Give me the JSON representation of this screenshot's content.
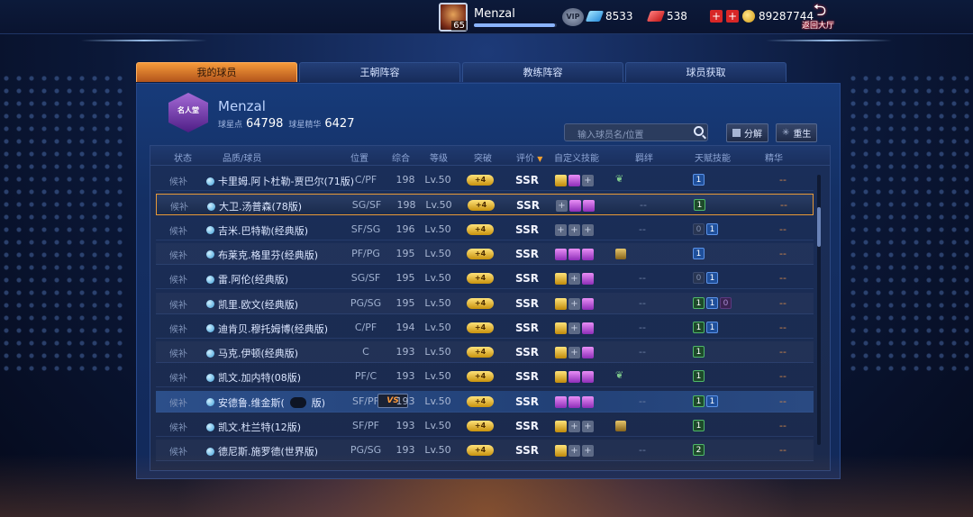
{
  "topbar": {
    "level": "65",
    "player_name": "Menzal",
    "xp_progress": 0.98,
    "vip_label": "VIP",
    "diamonds": "8533",
    "tickets": "538",
    "gold": "89287744",
    "back_label": "返回大厅"
  },
  "tabs": [
    {
      "label": "我的球员",
      "active": true
    },
    {
      "label": "王朝阵容",
      "active": false
    },
    {
      "label": "教练阵容",
      "active": false
    },
    {
      "label": "球员获取",
      "active": false
    }
  ],
  "profile": {
    "badge_text": "名人堂",
    "name": "Menzal",
    "star_points_label": "球星点",
    "star_points": "64798",
    "essence_label": "球星精华",
    "essence": "6427"
  },
  "search": {
    "placeholder": "输入球员名/位置"
  },
  "buttons": {
    "decompose": "分解",
    "rebirth": "重生"
  },
  "columns": {
    "status": "状态",
    "player": "品质/球员",
    "position": "位置",
    "overall": "综合",
    "level": "等级",
    "breakthrough": "突破",
    "rating": "评价",
    "custom_skills": "自定义技能",
    "bond": "羁绊",
    "talent": "天赋技能",
    "essence": "精华",
    "rating_sort_icon": "▼"
  },
  "rows": [
    {
      "status": "候补",
      "name": "卡里姆.阿卜杜勒-贾巴尔(71版)",
      "pos": "C/PF",
      "ovr": "198",
      "lv": "Lv.50",
      "brk": "+4",
      "rating": "SSR",
      "skills": [
        "g",
        "p",
        "e"
      ],
      "bond": "",
      "bond_icon": "leaf",
      "talent": [
        [
          "n",
          "1"
        ]
      ],
      "ess": "--"
    },
    {
      "status": "候补",
      "name": "大卫.汤普森(78版)",
      "pos": "SG/SF",
      "ovr": "198",
      "lv": "Lv.50",
      "brk": "+4",
      "rating": "SSR",
      "skills": [
        "e",
        "p",
        "p"
      ],
      "bond": "--",
      "bond_icon": "",
      "talent": [
        [
          "g",
          "1"
        ]
      ],
      "ess": "--"
    },
    {
      "status": "候补",
      "name": "吉米.巴特勒(经典版)",
      "pos": "SF/SG",
      "ovr": "196",
      "lv": "Lv.50",
      "brk": "+4",
      "rating": "SSR",
      "skills": [
        "e",
        "e",
        "e"
      ],
      "bond": "--",
      "bond_icon": "",
      "talent": [
        [
          "z",
          "0"
        ],
        [
          "n",
          "1"
        ]
      ],
      "ess": "--"
    },
    {
      "status": "候补",
      "name": "布莱克.格里芬(经典版)",
      "pos": "PF/PG",
      "ovr": "195",
      "lv": "Lv.50",
      "brk": "+4",
      "rating": "SSR",
      "skills": [
        "p",
        "p",
        "p"
      ],
      "bond": "",
      "bond_icon": "gold",
      "talent": [
        [
          "n",
          "1"
        ]
      ],
      "ess": "--"
    },
    {
      "status": "候补",
      "name": "雷.阿伦(经典版)",
      "pos": "SG/SF",
      "ovr": "195",
      "lv": "Lv.50",
      "brk": "+4",
      "rating": "SSR",
      "skills": [
        "g",
        "e",
        "p"
      ],
      "bond": "--",
      "bond_icon": "",
      "talent": [
        [
          "z",
          "0"
        ],
        [
          "n",
          "1"
        ]
      ],
      "ess": "--"
    },
    {
      "status": "候补",
      "name": "凯里.欧文(经典版)",
      "pos": "PG/SG",
      "ovr": "195",
      "lv": "Lv.50",
      "brk": "+4",
      "rating": "SSR",
      "skills": [
        "g",
        "e",
        "p"
      ],
      "bond": "--",
      "bond_icon": "",
      "talent": [
        [
          "g",
          "1"
        ],
        [
          "n",
          "1"
        ],
        [
          "pz",
          "0"
        ]
      ],
      "ess": "--"
    },
    {
      "status": "候补",
      "name": "迪肯贝.穆托姆博(经典版)",
      "pos": "C/PF",
      "ovr": "194",
      "lv": "Lv.50",
      "brk": "+4",
      "rating": "SSR",
      "skills": [
        "g",
        "e",
        "p"
      ],
      "bond": "--",
      "bond_icon": "",
      "talent": [
        [
          "g",
          "1"
        ],
        [
          "n",
          "1"
        ]
      ],
      "ess": "--"
    },
    {
      "status": "候补",
      "name": "马克.伊顿(经典版)",
      "pos": "C",
      "ovr": "193",
      "lv": "Lv.50",
      "brk": "+4",
      "rating": "SSR",
      "skills": [
        "g",
        "e",
        "p"
      ],
      "bond": "--",
      "bond_icon": "",
      "talent": [
        [
          "g",
          "1"
        ]
      ],
      "ess": "--"
    },
    {
      "status": "候补",
      "name": "凯文.加内特(08版)",
      "pos": "PF/C",
      "ovr": "193",
      "lv": "Lv.50",
      "brk": "+4",
      "rating": "SSR",
      "skills": [
        "g",
        "p",
        "p"
      ],
      "bond": "",
      "bond_icon": "leaf",
      "talent": [
        [
          "g",
          "1"
        ]
      ],
      "ess": "--"
    },
    {
      "status": "候补",
      "name": "安德鲁.维金斯(",
      "name_tail": "版)",
      "pos": "SF/PF",
      "ovr": "193",
      "lv": "Lv.50",
      "brk": "+4",
      "rating": "SSR",
      "skills": [
        "p",
        "p",
        "p"
      ],
      "bond": "--",
      "bond_icon": "",
      "talent": [
        [
          "g",
          "1"
        ],
        [
          "n",
          "1"
        ]
      ],
      "ess": "--",
      "vs_label": "VS"
    },
    {
      "status": "候补",
      "name": "凯文.杜兰特(12版)",
      "pos": "SF/PF",
      "ovr": "193",
      "lv": "Lv.50",
      "brk": "+4",
      "rating": "SSR",
      "skills": [
        "g",
        "e",
        "e"
      ],
      "bond": "",
      "bond_icon": "gold",
      "talent": [
        [
          "g",
          "1"
        ]
      ],
      "ess": "--"
    },
    {
      "status": "候补",
      "name": "德尼斯.施罗德(世界版)",
      "pos": "PG/SG",
      "ovr": "193",
      "lv": "Lv.50",
      "brk": "+4",
      "rating": "SSR",
      "skills": [
        "g",
        "e",
        "e"
      ],
      "bond": "--",
      "bond_icon": "",
      "talent": [
        [
          "g",
          "2"
        ]
      ],
      "ess": "--"
    }
  ]
}
